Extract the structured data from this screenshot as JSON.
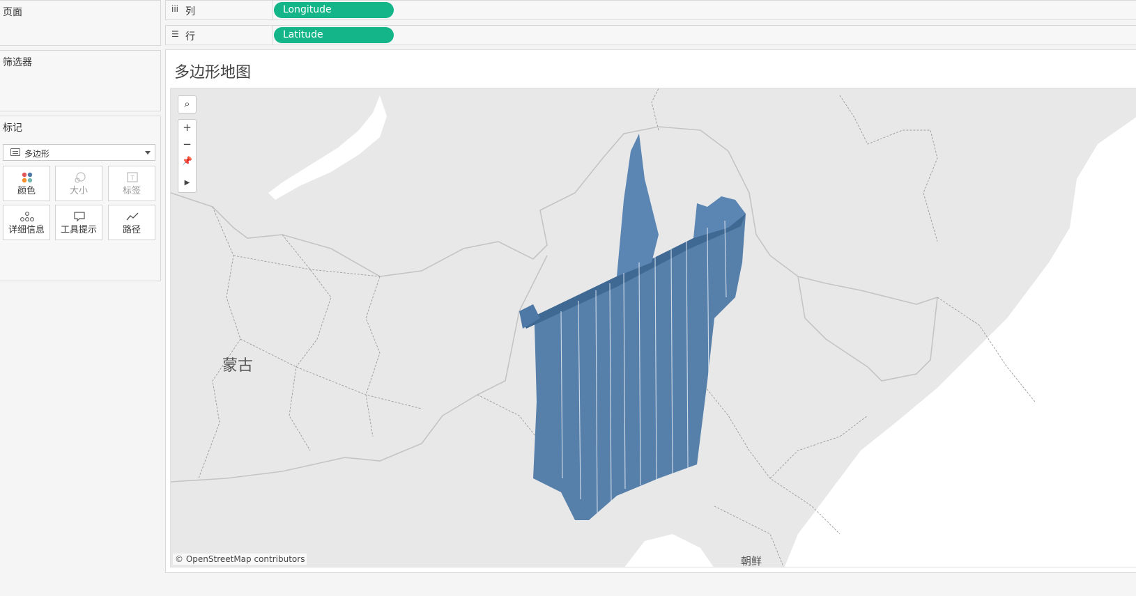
{
  "left_panel": {
    "pages": {
      "title": "页面"
    },
    "filters": {
      "title": "筛选器"
    },
    "marks": {
      "title": "标记",
      "mark_type": "多边形",
      "buttons": [
        {
          "label": "颜色",
          "icon": "color-icon",
          "enabled": true
        },
        {
          "label": "大小",
          "icon": "size-icon",
          "enabled": false
        },
        {
          "label": "标签",
          "icon": "label-icon",
          "enabled": false
        },
        {
          "label": "详细信息",
          "icon": "detail-icon",
          "enabled": true
        },
        {
          "label": "工具提示",
          "icon": "tooltip-icon",
          "enabled": true
        },
        {
          "label": "路径",
          "icon": "path-icon",
          "enabled": true
        }
      ]
    }
  },
  "shelves": {
    "columns": {
      "label": "列",
      "icon": "columns-icon",
      "pill": "Longitude"
    },
    "rows": {
      "label": "行",
      "icon": "rows-icon",
      "pill": "Latitude"
    }
  },
  "view": {
    "title": "多边形地图",
    "map": {
      "labels": {
        "mongolia": "蒙古",
        "korea": "朝鲜"
      },
      "attribution": "© OpenStreetMap contributors",
      "controls": [
        "search-icon",
        "zoom-in-icon",
        "zoom-out-icon",
        "pin-icon",
        "play-icon"
      ],
      "polygon_color": "#4e79a7"
    }
  },
  "colors": {
    "pill": "#13b589",
    "map_background": "#e8e8e8",
    "polygon": "#4e79a7"
  }
}
